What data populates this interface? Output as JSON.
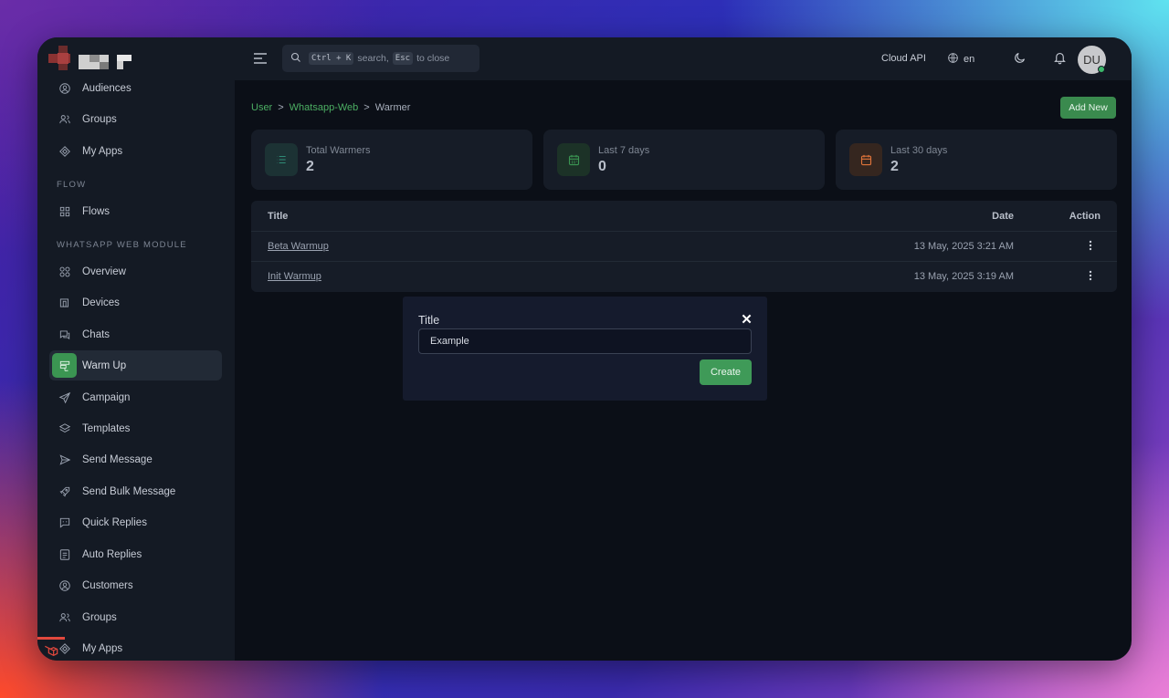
{
  "sidebar": {
    "items": [
      {
        "label": "Audiences",
        "icon": "user-circle-icon"
      },
      {
        "label": "Groups",
        "icon": "users-icon"
      },
      {
        "label": "My Apps",
        "icon": "apps-icon"
      },
      {
        "label": "Flows",
        "icon": "grid-icon"
      },
      {
        "label": "Overview",
        "icon": "overview-icon"
      },
      {
        "label": "Devices",
        "icon": "devices-icon"
      },
      {
        "label": "Chats",
        "icon": "chat-icon"
      },
      {
        "label": "Warm Up",
        "icon": "warmup-icon"
      },
      {
        "label": "Campaign",
        "icon": "send-icon"
      },
      {
        "label": "Templates",
        "icon": "layers-icon"
      },
      {
        "label": "Send Message",
        "icon": "paper-plane-icon"
      },
      {
        "label": "Send Bulk Message",
        "icon": "rocket-icon"
      },
      {
        "label": "Quick Replies",
        "icon": "message-square-icon"
      },
      {
        "label": "Auto Replies",
        "icon": "file-text-icon"
      },
      {
        "label": "Customers",
        "icon": "user-circle-icon"
      },
      {
        "label": "Groups",
        "icon": "users-icon"
      },
      {
        "label": "My Apps",
        "icon": "apps-icon"
      }
    ],
    "sections": {
      "flow": "FLOW",
      "whatsapp": "WHATSAPP WEB MODULE"
    }
  },
  "topbar": {
    "search": {
      "kbd1": "Ctrl + K",
      "text1": "search,",
      "kbd2": "Esc",
      "text2": "to close"
    },
    "cloud_api": "Cloud API",
    "lang": "en",
    "avatar": "DU"
  },
  "breadcrumb": {
    "first": "User",
    "second": "Whatsapp-Web",
    "current": "Warmer",
    "sep": ">"
  },
  "actions": {
    "add_new": "Add New"
  },
  "stats": [
    {
      "label": "Total Warmers",
      "value": "2",
      "color": "#2f8b76"
    },
    {
      "label": "Last 7 days",
      "value": "0",
      "color": "#3b9552"
    },
    {
      "label": "Last 30 days",
      "value": "2",
      "color": "#e0743a"
    }
  ],
  "table": {
    "headers": {
      "title": "Title",
      "date": "Date",
      "action": "Action"
    },
    "rows": [
      {
        "title": "Beta Warmup",
        "date": "13 May, 2025 3:21 AM"
      },
      {
        "title": "Init Warmup",
        "date": "13 May, 2025 3:19 AM"
      }
    ]
  },
  "modal": {
    "label": "Title",
    "value": "Example",
    "create": "Create"
  }
}
